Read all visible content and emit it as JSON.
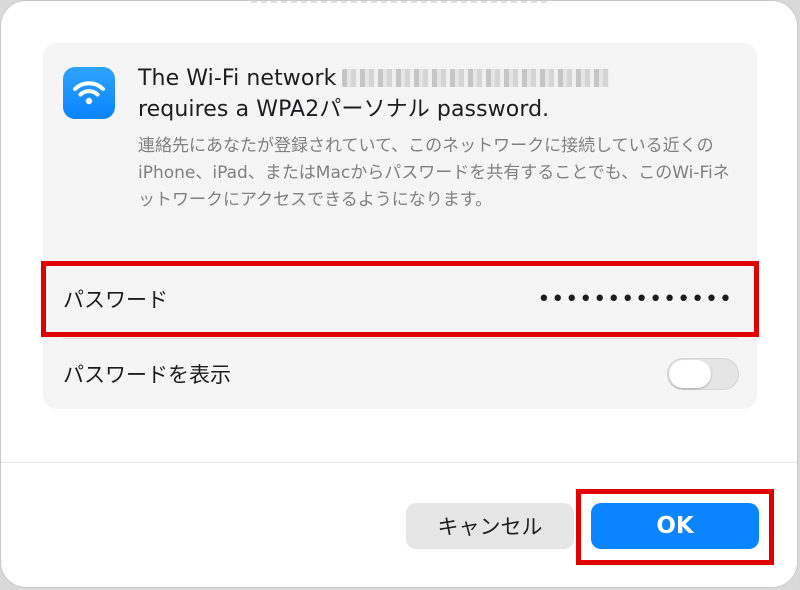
{
  "dialog": {
    "title_prefix": "The Wi-Fi network",
    "title_suffix": "requires a WPA2パーソナル password.",
    "description": "連絡先にあなたが登録されていて、このネットワークに接続している近くのiPhone、iPad、またはMacからパスワードを共有することでも、このWi-Fiネットワークにアクセスできるようになります。"
  },
  "icon": {
    "name": "wifi-icon",
    "color": "#0a84ff"
  },
  "password": {
    "label": "パスワード",
    "value": "••••••••••••••"
  },
  "show_password": {
    "label": "パスワードを表示",
    "enabled": false
  },
  "buttons": {
    "cancel_label": "キャンセル",
    "ok_label": "OK"
  },
  "colors": {
    "accent": "#0a84ff",
    "highlight": "#e00000"
  }
}
